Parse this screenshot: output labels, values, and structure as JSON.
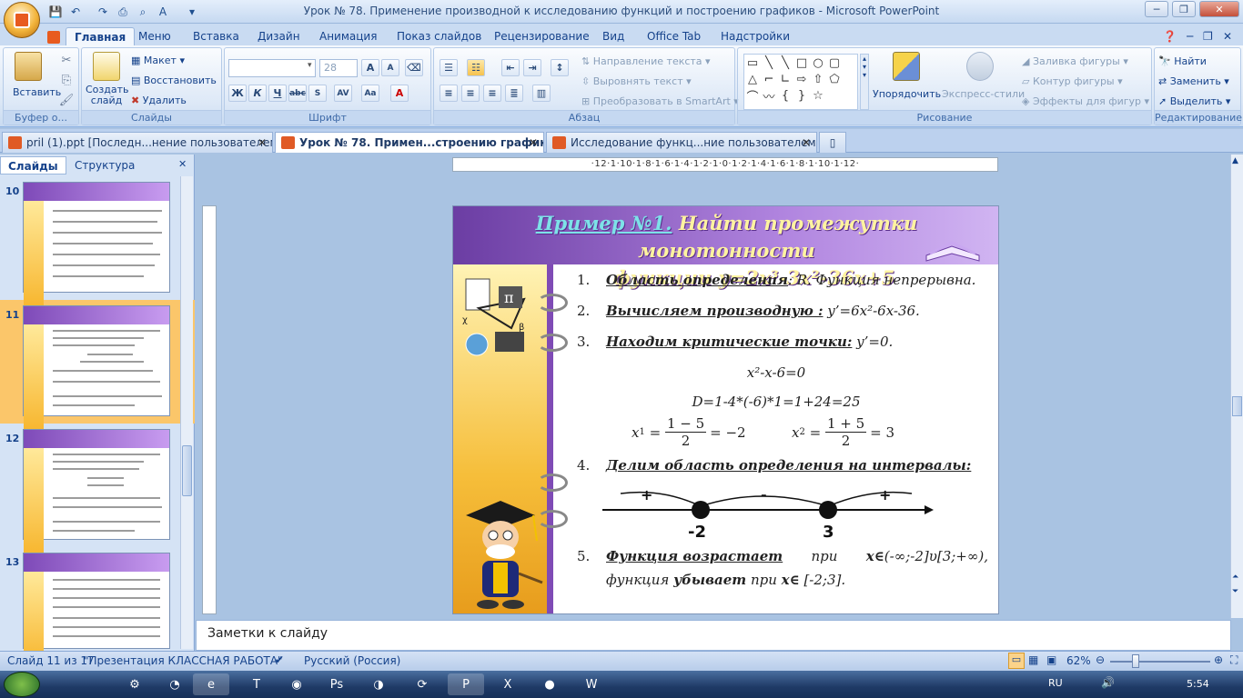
{
  "window": {
    "title": "Урок № 78. Применение производной к исследованию функций и построению графиков - Microsoft PowerPoint"
  },
  "ribbon_tabs": [
    "Главная",
    "Меню",
    "Вставка",
    "Дизайн",
    "Анимация",
    "Показ слайдов",
    "Рецензирование",
    "Вид",
    "Office Tab",
    "Надстройки"
  ],
  "ribbon": {
    "clipboard": {
      "paste": "Вставить",
      "label": "Буфер о..."
    },
    "slides": {
      "new_slide": "Создать слайд",
      "layout": "Макет",
      "reset": "Восстановить",
      "delete": "Удалить",
      "label": "Слайды"
    },
    "font": {
      "size": "28",
      "label": "Шрифт"
    },
    "paragraph": {
      "text_direction": "Направление текста",
      "align_text": "Выровнять текст",
      "smartart": "Преобразовать в SmartArt",
      "label": "Абзац"
    },
    "drawing": {
      "arrange": "Упорядочить",
      "quick_styles": "Экспресс-стили",
      "fill": "Заливка фигуры",
      "outline": "Контур фигуры",
      "effects": "Эффекты для фигур",
      "label": "Рисование"
    },
    "editing": {
      "find": "Найти",
      "replace": "Заменить",
      "select": "Выделить",
      "label": "Редактирование"
    }
  },
  "doc_tabs": [
    {
      "label": "pril (1).ppt [Последн...нение пользователем]",
      "active": false
    },
    {
      "label": "Урок № 78. Примен...строению графиков",
      "active": true
    },
    {
      "label": "Исследование функц...ние пользователем]",
      "active": false
    }
  ],
  "left_pane": {
    "tabs": [
      "Слайды",
      "Структура"
    ],
    "thumbnails": [
      {
        "num": "10"
      },
      {
        "num": "11",
        "selected": true
      },
      {
        "num": "12"
      },
      {
        "num": "13"
      }
    ]
  },
  "ruler_text": "·12·1·10·1·8·1·6·1·4·1·2·1·0·1·2·1·4·1·6·1·8·1·10·1·12·",
  "slide": {
    "title_prefix": "Пример №1.",
    "title_line1": " Найти промежутки монотонности",
    "title_line2": "функции y=2x³-3x²-36x+5",
    "items": [
      {
        "n": "1.",
        "bold": "Область определения",
        "rest": ": R. Функция непрерывна."
      },
      {
        "n": "2.",
        "bold": "Вычисляем производную :",
        "rest": " y’=6x²-6x-36."
      },
      {
        "n": "3.",
        "bold": "Находим критические точки:",
        "rest": " y’=0."
      }
    ],
    "eq1": "x²-x-6=0",
    "eq2": "D=1-4*(-6)*1=1+24=25",
    "x1": {
      "lhs": "x",
      "sub": "1",
      "num": "1 − 5",
      "den": "2",
      "rhs": "= −2"
    },
    "x2": {
      "lhs": "x",
      "sub": "2",
      "num": "1 + 5",
      "den": "2",
      "rhs": "= 3"
    },
    "item4": {
      "n": "4.",
      "bold": "Делим область определения на интервалы:"
    },
    "signs": [
      "+",
      "-",
      "+"
    ],
    "points": [
      "-2",
      "3"
    ],
    "item5": {
      "n": "5.",
      "line1_a": "Функция возрастает",
      "line1_b": " при ",
      "line1_c": "x∈",
      "line1_d": "(-∞;-2]υ[3;+∞),",
      "line2_a": "функция ",
      "line2_b": "убывает",
      "line2_c": " при ",
      "line2_d": "x∈",
      "line2_e": " [-2;3]."
    }
  },
  "notes_placeholder": "Заметки к слайду",
  "status": {
    "slide_counter": "Слайд 11 из 17",
    "theme": "\"Презентация КЛАССНАЯ РАБОТА\"",
    "language": "Русский (Россия)",
    "zoom": "62%"
  },
  "taskbar": {
    "lang": "RU",
    "time": "5:54"
  },
  "colors": {
    "accent": "#15428b",
    "slide_purple": "#7f4bb5",
    "slide_yellow": "#f6be3a"
  }
}
